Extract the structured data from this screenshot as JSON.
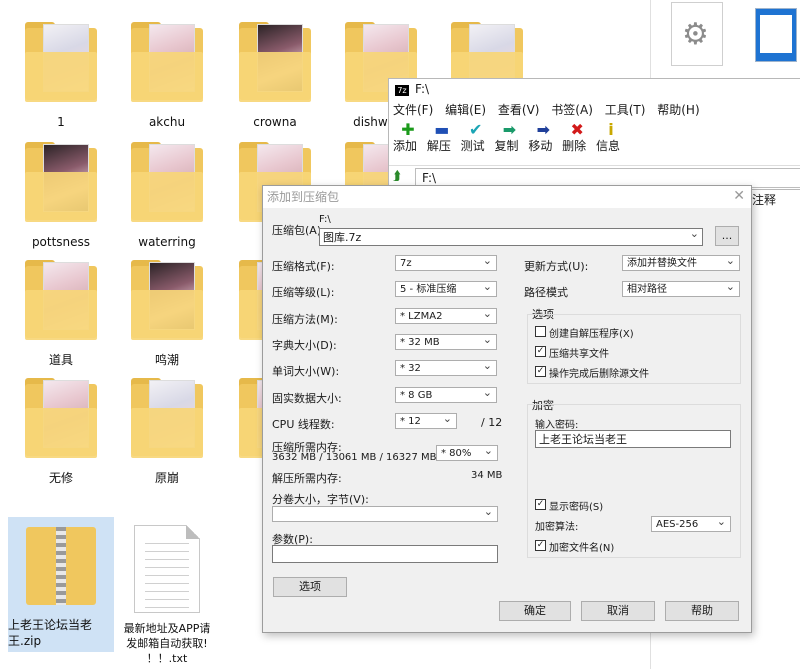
{
  "explorer": {
    "folders": [
      {
        "name": "1"
      },
      {
        "name": "akchu"
      },
      {
        "name": "crowna"
      },
      {
        "name": "dishwash"
      },
      {
        "name": ""
      },
      {
        "name": "pottsness"
      },
      {
        "name": "waterring"
      },
      {
        "name": "道具"
      },
      {
        "name": "鸣潮"
      },
      {
        "name": "无修"
      },
      {
        "name": "原崩"
      }
    ],
    "zip_file": {
      "line1": "上老王论坛当老",
      "line2": "王.zip"
    },
    "txt_file": {
      "line1": "最新地址及APP请",
      "line2": "发邮箱自动获取!",
      "line3": "！！.txt"
    },
    "side_label": "注释"
  },
  "fm": {
    "title": "F:\\",
    "logo": "7z",
    "menu": [
      "文件(F)",
      "编辑(E)",
      "查看(V)",
      "书签(A)",
      "工具(T)",
      "帮助(H)"
    ],
    "toolbar": [
      {
        "icon": "add-icon",
        "glyph": "✚",
        "color": "#1a9a1a",
        "label": "添加"
      },
      {
        "icon": "extract-icon",
        "glyph": "▬",
        "color": "#1f4fb5",
        "label": "解压"
      },
      {
        "icon": "test-icon",
        "glyph": "✔",
        "color": "#1aa5b5",
        "label": "测试"
      },
      {
        "icon": "copy-icon",
        "glyph": "➡",
        "color": "#1a9a6a",
        "label": "复制"
      },
      {
        "icon": "move-icon",
        "glyph": "➡",
        "color": "#1f3f9a",
        "label": "移动"
      },
      {
        "icon": "delete-icon",
        "glyph": "✖",
        "color": "#d21a1a",
        "label": "删除"
      },
      {
        "icon": "info-icon",
        "glyph": "i",
        "color": "#c9a800",
        "label": "信息"
      }
    ],
    "path": "F:\\"
  },
  "dialog": {
    "title": "添加到压缩包",
    "archive_label": "压缩包(A)",
    "archive_dir": "F:\\",
    "archive_name": "图库.7z",
    "browse_label": "...",
    "format_label": "压缩格式(F):",
    "format_value": "7z",
    "level_label": "压缩等级(L):",
    "level_value": "5 - 标准压缩",
    "method_label": "压缩方法(M):",
    "method_value": "* LZMA2",
    "dict_label": "字典大小(D):",
    "dict_value": "* 32 MB",
    "word_label": "单词大小(W):",
    "word_value": "* 32",
    "solid_label": "固实数据大小:",
    "solid_value": "* 8 GB",
    "cpu_label": "CPU 线程数:",
    "cpu_value": "* 12",
    "cpu_total": "/ 12",
    "mem_label": "压缩所需内存:",
    "mem_detail": "3632 MB / 13061 MB / 16327 MB",
    "mem_percent": "* 80%",
    "decomp_label": "解压所需内存:",
    "decomp_value": "34 MB",
    "split_label": "分卷大小，字节(V):",
    "params_label": "参数(P):",
    "options_button": "选项",
    "update_label": "更新方式(U):",
    "update_value": "添加并替换文件",
    "pathmode_label": "路径模式",
    "pathmode_value": "相对路径",
    "options_group": "选项",
    "opt_sfx": "创建自解压程序(X)",
    "opt_shared": "压缩共享文件",
    "opt_delete": "操作完成后删除源文件",
    "encrypt_group": "加密",
    "password_label": "输入密码:",
    "password_value": "上老王论坛当老王",
    "show_password": "显示密码(S)",
    "enc_method_label": "加密算法:",
    "enc_method_value": "AES-256",
    "encrypt_names": "加密文件名(N)",
    "ok": "确定",
    "cancel": "取消",
    "help": "帮助"
  }
}
